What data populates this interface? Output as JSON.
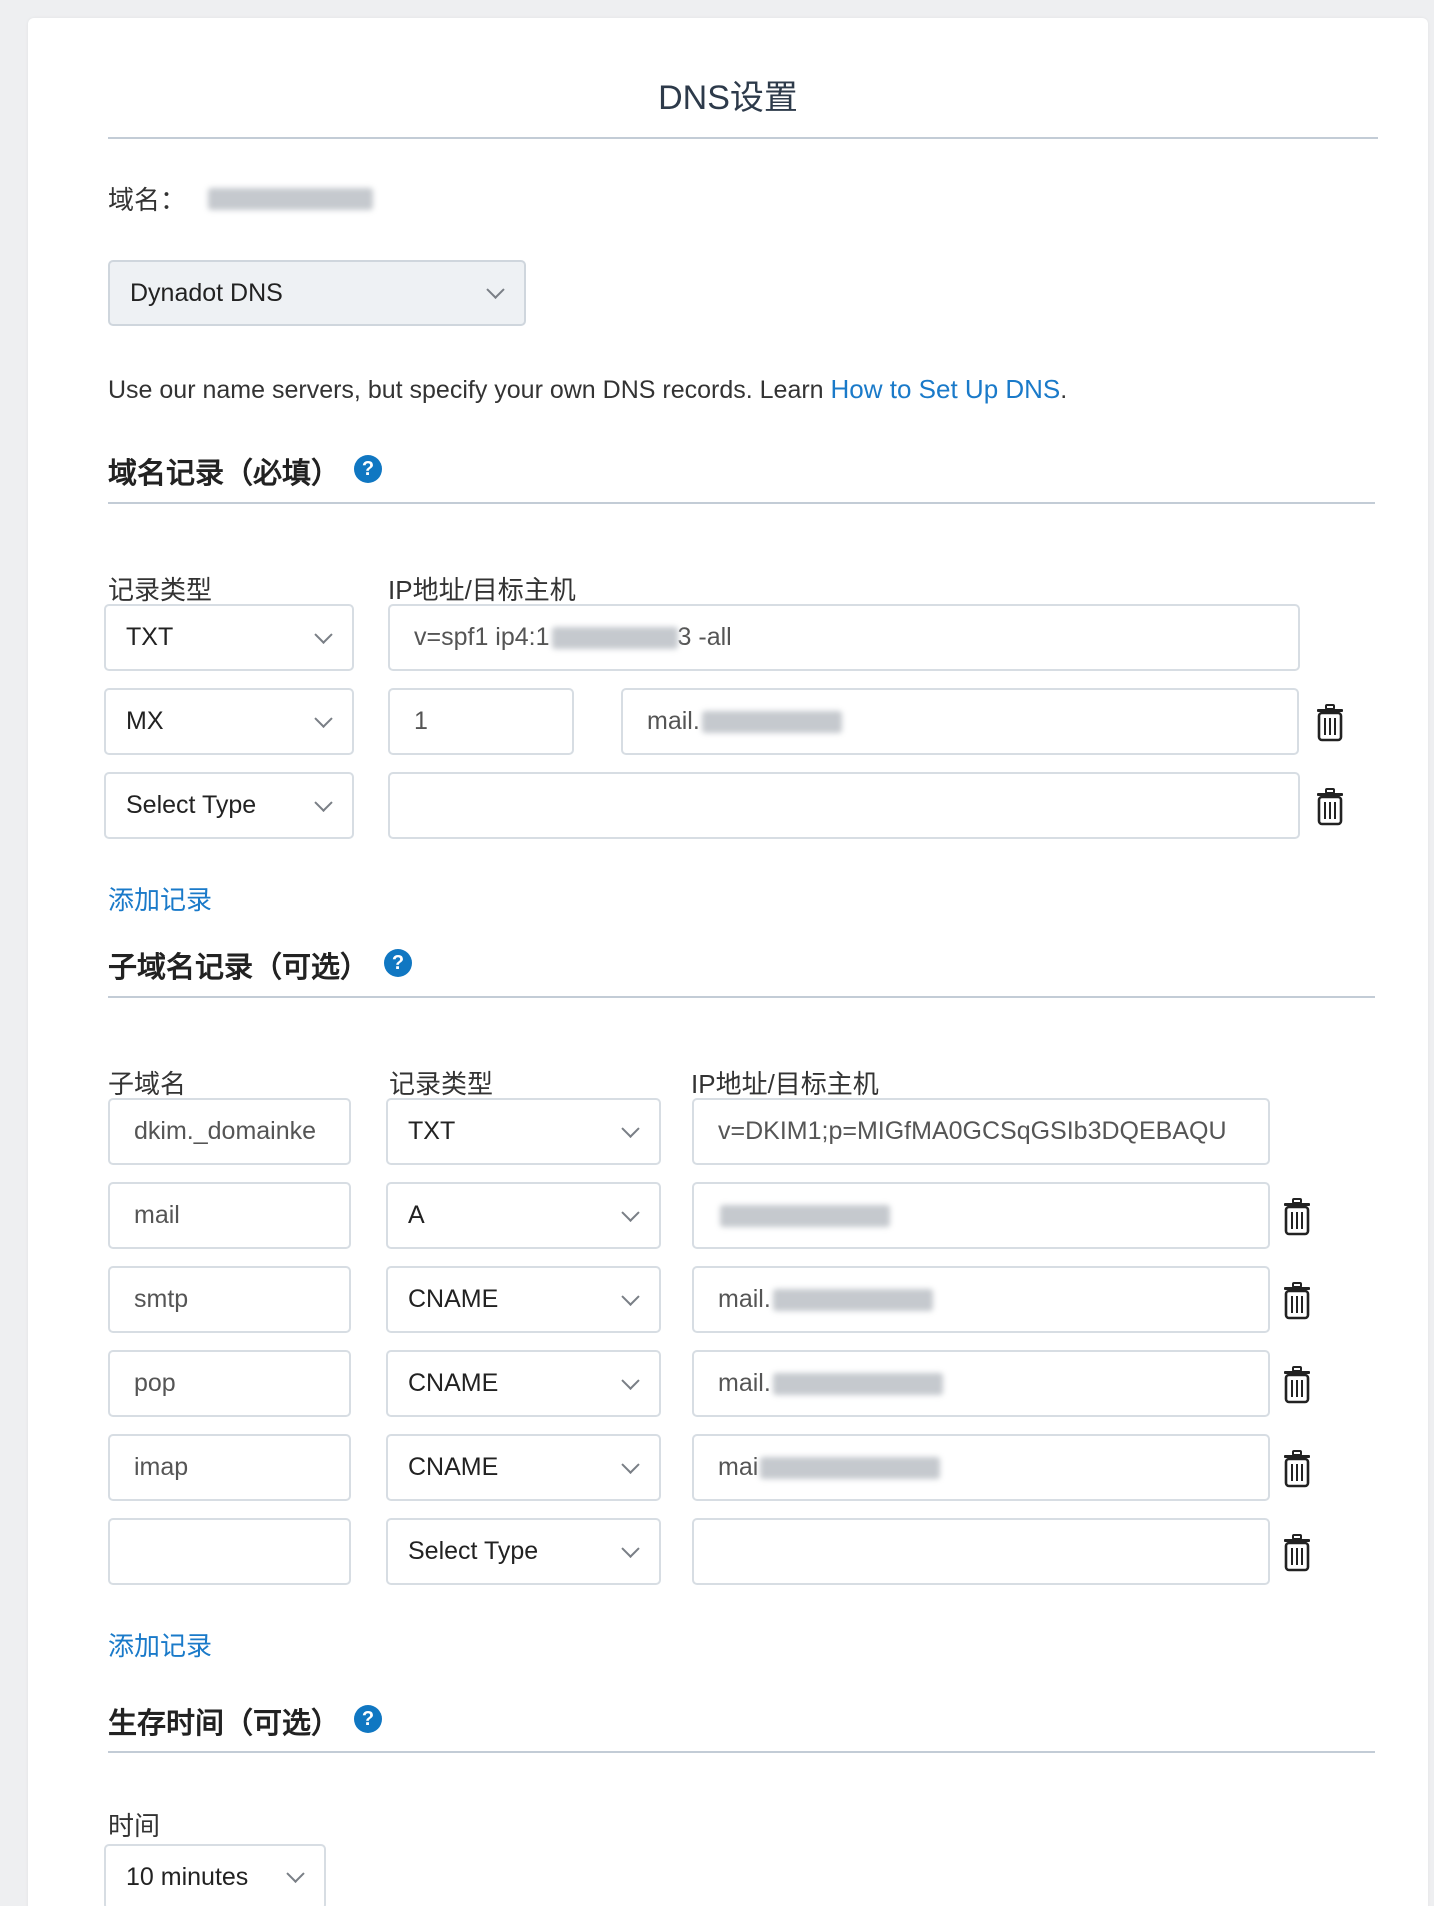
{
  "page_title": "DNS设置",
  "domain_label": "域名：",
  "ns_select": {
    "value": "Dynadot DNS"
  },
  "description": {
    "text": "Use our name servers, but specify your own DNS records. Learn ",
    "link": "How to Set Up DNS",
    "end": "."
  },
  "domain_records": {
    "heading": "域名记录（必填）",
    "help_glyph": "?",
    "col_type": "记录类型",
    "col_target": "IP地址/目标主机",
    "rows": [
      {
        "type": "TXT",
        "target_prefix": "v=spf1 ip4:1",
        "target_suffix": "3 -all"
      },
      {
        "type": "MX",
        "priority": "1",
        "target_prefix": "mail."
      },
      {
        "type": "Select Type",
        "target_prefix": ""
      }
    ],
    "add_link": "添加记录"
  },
  "subdomain_records": {
    "heading": "子域名记录（可选）",
    "help_glyph": "?",
    "col_sub": "子域名",
    "col_type": "记录类型",
    "col_target": "IP地址/目标主机",
    "rows": [
      {
        "sub": "dkim._domainke",
        "type": "TXT",
        "target": "v=DKIM1;p=MIGfMA0GCSqGSIb3DQEBAQU"
      },
      {
        "sub": "mail",
        "type": "A",
        "target": ""
      },
      {
        "sub": "smtp",
        "type": "CNAME",
        "target": "mail."
      },
      {
        "sub": "pop",
        "type": "CNAME",
        "target": "mail."
      },
      {
        "sub": "imap",
        "type": "CNAME",
        "target": "mai"
      },
      {
        "sub": "",
        "type": "Select Type",
        "target": ""
      }
    ],
    "add_link": "添加记录"
  },
  "ttl": {
    "heading": "生存时间（可选）",
    "help_glyph": "?",
    "label": "时间",
    "value": "10 minutes"
  },
  "icons": [
    "chevron-down-icon",
    "trash-icon",
    "help-icon"
  ],
  "colors": {
    "link": "#1a7ac9",
    "help": "#1077c2",
    "rule": "#c3ccd6"
  }
}
